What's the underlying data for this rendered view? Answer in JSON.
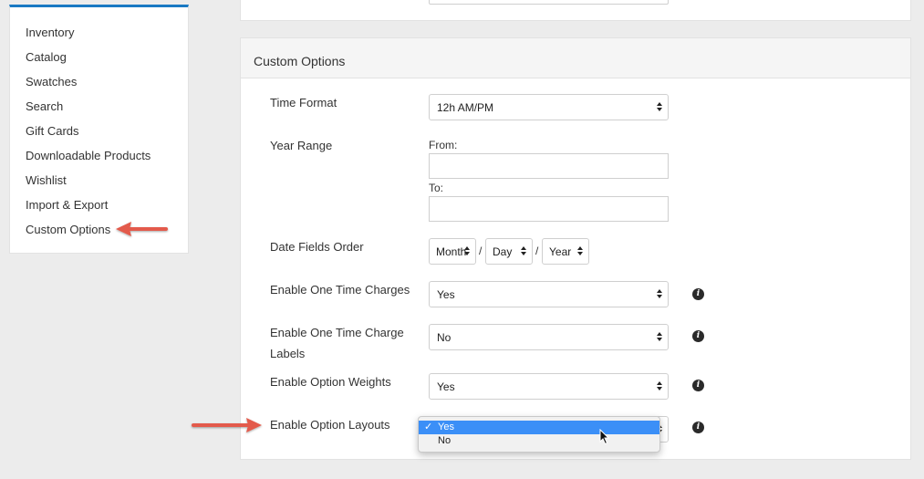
{
  "sidebar": {
    "items": [
      {
        "label": "Inventory"
      },
      {
        "label": "Catalog"
      },
      {
        "label": "Swatches"
      },
      {
        "label": "Search"
      },
      {
        "label": "Gift Cards"
      },
      {
        "label": "Downloadable Products"
      },
      {
        "label": "Wishlist"
      },
      {
        "label": "Import & Export"
      },
      {
        "label": "Custom Options"
      }
    ]
  },
  "panel": {
    "title": "Custom Options",
    "time_format": {
      "label": "Time Format",
      "value": "12h AM/PM"
    },
    "year_range": {
      "label": "Year Range",
      "from_label": "From:",
      "to_label": "To:",
      "from_value": "",
      "to_value": ""
    },
    "date_fields_order": {
      "label": "Date Fields Order",
      "first": "Month",
      "second": "Day",
      "third": "Year",
      "separator": "/"
    },
    "one_time_charges": {
      "label": "Enable One Time Charges",
      "value": "Yes"
    },
    "one_time_charge_labels": {
      "label": "Enable One Time Charge Labels",
      "value": "No"
    },
    "option_weights": {
      "label": "Enable Option Weights",
      "value": "Yes"
    },
    "option_layouts": {
      "label": "Enable Option Layouts",
      "options": [
        {
          "label": "Yes",
          "selected": true
        },
        {
          "label": "No",
          "selected": false
        }
      ]
    }
  },
  "colors": {
    "accent_blue": "#1979c3",
    "highlight_blue": "#3b8ff7",
    "annotation_red": "#e35a4b"
  },
  "icons": {
    "info": "info-icon",
    "check": "checkmark-icon",
    "pointer": "mouse-pointer-icon",
    "annotation": "red-arrow-icon"
  }
}
